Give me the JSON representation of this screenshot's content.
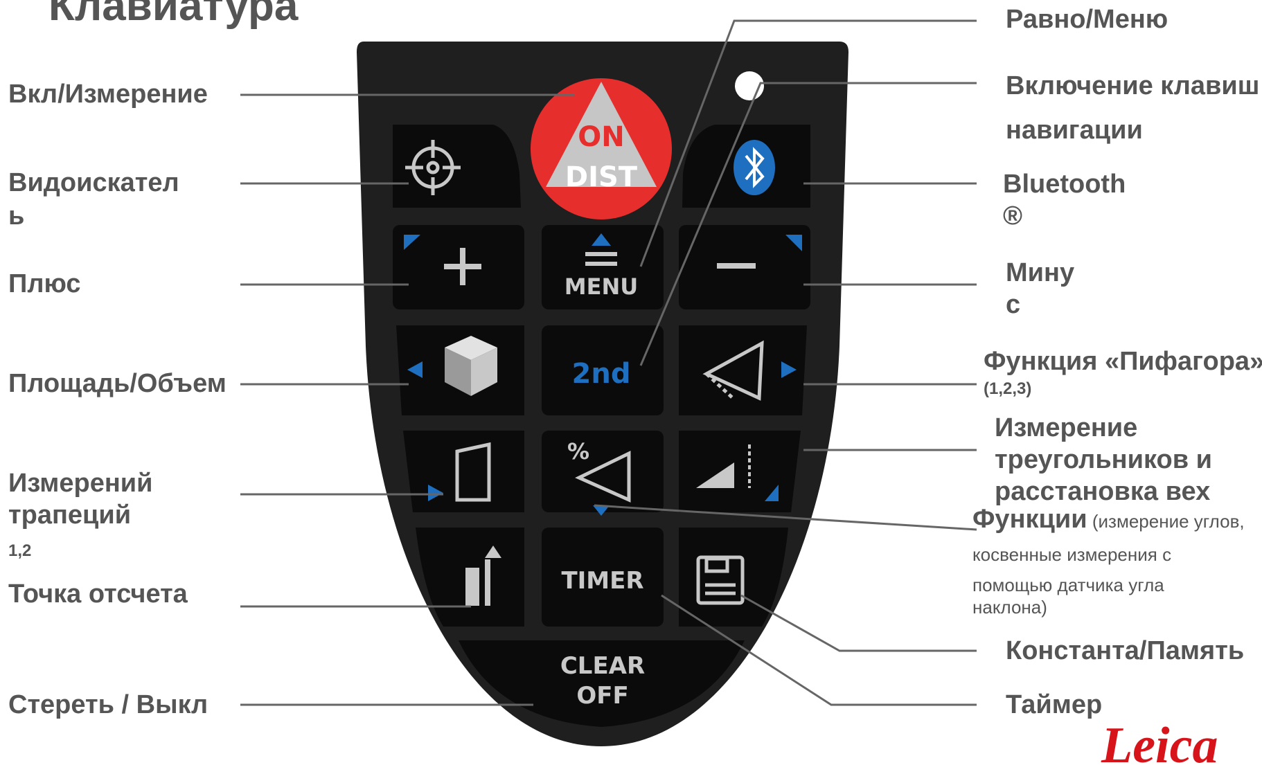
{
  "title": "Клавиатура",
  "labels_left": {
    "on_dist": "Вкл/Измерение",
    "viewfinder_1": "Видоискател",
    "viewfinder_2": "ь",
    "plus": "Плюс",
    "area_volume": "Площадь/Объем",
    "trapezoid_1": "Измерений",
    "trapezoid_2": "трапеций",
    "trapezoid_3": "1,2",
    "reference": "Точка отсчета",
    "clear_off": "Стереть / Выкл"
  },
  "labels_right": {
    "equal_menu": "Равно/Меню",
    "nav_1": "Включение клавиш",
    "nav_2": "навигации",
    "bluetooth_1": "Bluetooth",
    "bluetooth_2": "®",
    "minus_1": "Мину",
    "minus_2": "с",
    "pythagoras": "Функция «Пифагора»",
    "pythagoras_sub": "(1,2,3)",
    "triangle_1": "Измерение",
    "triangle_2": "треугольников и",
    "triangle_3": "расстановка вех",
    "functions_bold": "Функции",
    "functions_1": " (измерение углов,",
    "functions_2": " косвенные измерения с",
    "functions_3": "помощью датчика угла",
    "functions_4": "наклона)",
    "constant_memory": "Константа/Память",
    "timer": "Таймер"
  },
  "keys": {
    "on": "ON",
    "dist": "DIST",
    "menu": "MENU",
    "second": "2nd",
    "percent": "%",
    "timer": "TIMER",
    "clear": "CLEAR",
    "off": "OFF"
  },
  "logo": "Leica",
  "colors": {
    "text": "#555555",
    "body": "#1f1f1f",
    "key": "#0b0b0b",
    "accent_blue": "#1f6fc0",
    "on_red": "#e62e2d",
    "icon_grey": "#c8c8c8",
    "leader_line": "#666666"
  },
  "icons": [
    "crosshair-icon",
    "bluetooth-icon",
    "plus-icon",
    "minus-icon",
    "menu-icon",
    "cube-icon",
    "pythagoras-icon",
    "trapezoid-icon",
    "angle-icon",
    "stakeout-icon",
    "reference-icon",
    "memory-icon"
  ]
}
